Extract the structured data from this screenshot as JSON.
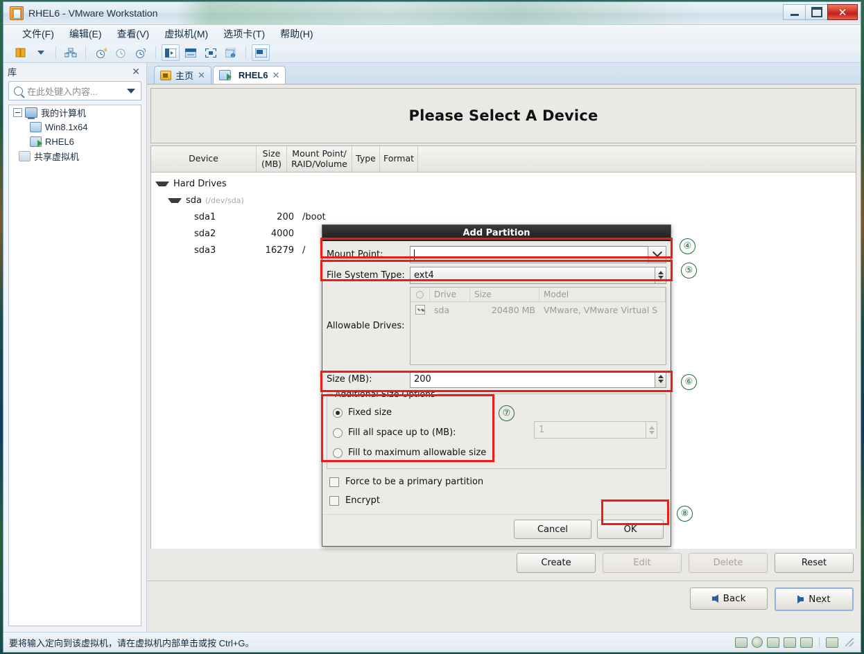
{
  "window": {
    "title": "RHEL6 - VMware Workstation",
    "app_icon": "vmware-icon",
    "minimize": "minimize-button",
    "restore": "restore-button",
    "close": "✕"
  },
  "menubar": [
    {
      "label": "文件(F)",
      "name": "menu-file"
    },
    {
      "label": "编辑(E)",
      "name": "menu-edit"
    },
    {
      "label": "查看(V)",
      "name": "menu-view"
    },
    {
      "label": "虚拟机(M)",
      "name": "menu-vm"
    },
    {
      "label": "选项卡(T)",
      "name": "menu-tabs"
    },
    {
      "label": "帮助(H)",
      "name": "menu-help"
    }
  ],
  "library": {
    "title": "库",
    "close_label": "✕",
    "search_placeholder": "在此处键入内容...",
    "tree": [
      {
        "label": "我的计算机",
        "icon": "computer-icon",
        "level": 0,
        "expander": true
      },
      {
        "label": "Win8.1x64",
        "icon": "vm-icon",
        "level": 1,
        "expander": false
      },
      {
        "label": "RHEL6",
        "icon": "vm-running-icon",
        "level": 1,
        "expander": false
      },
      {
        "label": "共享虚拟机",
        "icon": "shared-vm-icon",
        "level": 0,
        "expander": false
      }
    ]
  },
  "tabs": [
    {
      "label": "主页",
      "icon": "home-icon",
      "active": false,
      "close": "✕"
    },
    {
      "label": "RHEL6",
      "icon": "vm-running-icon",
      "active": true,
      "close": "✕"
    }
  ],
  "anaconda": {
    "title": "Please Select A Device",
    "table_headers": [
      {
        "label": "Device"
      },
      {
        "label": "Size\n(MB)"
      },
      {
        "label": "Mount Point/\nRAID/Volume"
      },
      {
        "label": "Type"
      },
      {
        "label": "Format"
      }
    ],
    "header_size_l1": "Size",
    "header_size_l2": "(MB)",
    "header_mp_l1": "Mount Point/",
    "header_mp_l2": "RAID/Volume",
    "header_device": "Device",
    "header_type": "Type",
    "header_format": "Format",
    "rows": [
      {
        "device": "Hard Drives",
        "dev_sub": "",
        "size": "",
        "mount": "",
        "indent": 0,
        "expander": true
      },
      {
        "device": "sda",
        "dev_sub": "(/dev/sda)",
        "size": "",
        "mount": "",
        "indent": 1,
        "expander": true
      },
      {
        "device": "sda1",
        "dev_sub": "",
        "size": "200",
        "mount": "/boot",
        "indent": 2,
        "expander": false
      },
      {
        "device": "sda2",
        "dev_sub": "",
        "size": "4000",
        "mount": "",
        "indent": 2,
        "expander": false
      },
      {
        "device": "sda3",
        "dev_sub": "",
        "size": "16279",
        "mount": "/",
        "indent": 2,
        "expander": false
      }
    ],
    "crud_buttons": [
      {
        "label": "Create",
        "name": "create-button",
        "disabled": false
      },
      {
        "label": "Edit",
        "name": "edit-button",
        "disabled": true
      },
      {
        "label": "Delete",
        "name": "delete-button",
        "disabled": true
      },
      {
        "label": "Reset",
        "name": "reset-button",
        "disabled": false
      }
    ],
    "nav_buttons": [
      {
        "label": "Back",
        "name": "back-button",
        "icon": "arrow-left-icon"
      },
      {
        "label": "Next",
        "name": "next-button",
        "icon": "arrow-right-icon"
      }
    ]
  },
  "dialog": {
    "title": "Add Partition",
    "mount_point_label": "Mount Point:",
    "mount_point_value": "",
    "fs_type_label": "File System Type:",
    "fs_type_value": "ext4",
    "allowable_drives_label": "Allowable Drives:",
    "drive_columns": [
      "",
      "Drive",
      "Size",
      "Model"
    ],
    "drive_col_drive": "Drive",
    "drive_col_size": "Size",
    "drive_col_model": "Model",
    "drives": [
      {
        "checked": true,
        "drive": "sda",
        "size": "20480 MB",
        "model": "VMware, VMware Virtual S"
      }
    ],
    "size_label": "Size (MB):",
    "size_value": "200",
    "aso_legend": "Additional Size Options",
    "aso_options": [
      {
        "label": "Fixed size",
        "selected": true
      },
      {
        "label": "Fill all space up to (MB):",
        "selected": false
      },
      {
        "label": "Fill to maximum allowable size",
        "selected": false
      }
    ],
    "fill_value": "1",
    "force_primary_label": "Force to be a primary partition",
    "force_primary_checked": false,
    "encrypt_label": "Encrypt",
    "encrypt_checked": false,
    "cancel_label": "Cancel",
    "ok_label": "OK"
  },
  "annotations": [
    {
      "number": "④",
      "target": "mount-point-row"
    },
    {
      "number": "⑤",
      "target": "fs-type-row"
    },
    {
      "number": "⑥",
      "target": "size-row"
    },
    {
      "number": "⑦",
      "target": "additional-size-options"
    },
    {
      "number": "⑧",
      "target": "ok-button"
    }
  ],
  "statusbar": {
    "message": "要将输入定向到该虚拟机，请在虚拟机内部单击或按 Ctrl+G。"
  },
  "colors": {
    "annotation_red": "#ee1c16",
    "annotation_green": "#1f6b34",
    "dialog_titlebar": "#1d1d1d",
    "desktop": "#1d4d3a"
  }
}
